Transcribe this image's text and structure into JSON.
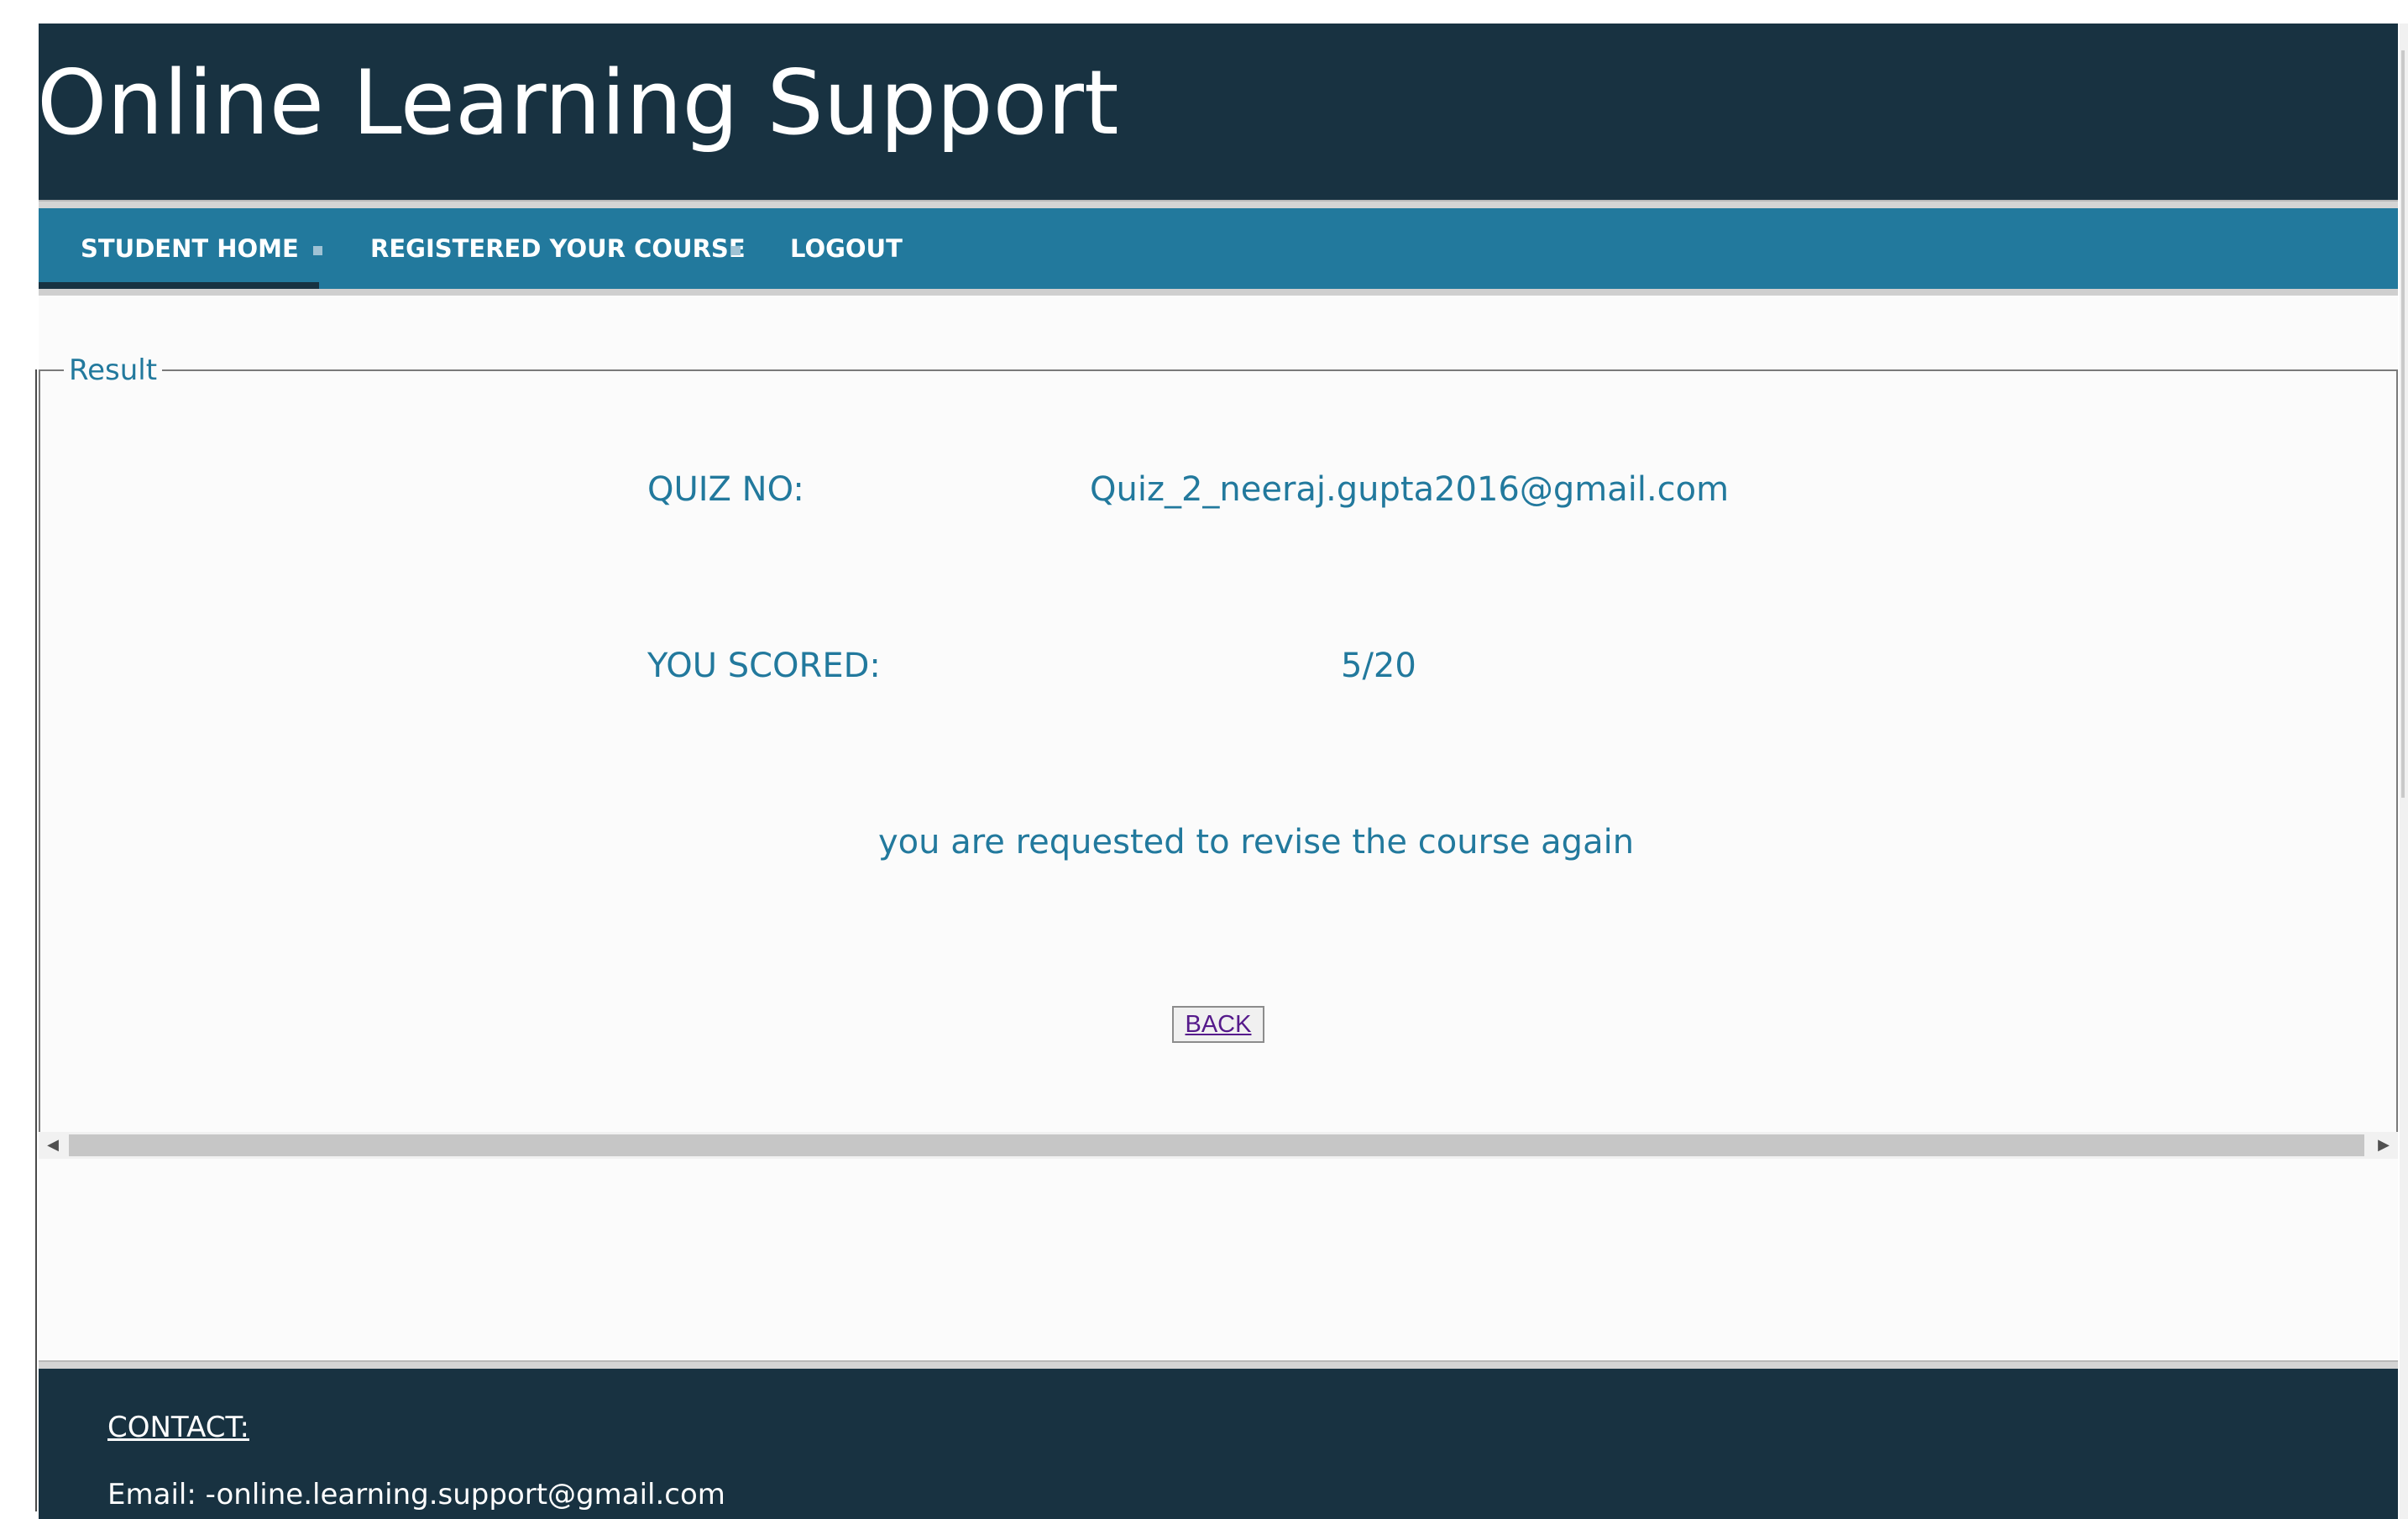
{
  "header": {
    "title": "Online Learning Support"
  },
  "nav": {
    "items": [
      {
        "label": "STUDENT HOME",
        "active": true
      },
      {
        "label": "REGISTERED YOUR COURSE",
        "active": false
      },
      {
        "label": "LOGOUT",
        "active": false
      }
    ]
  },
  "result": {
    "legend": "Result",
    "quiz_label": "QUIZ NO:",
    "quiz_value": "Quiz_2_neeraj.gupta2016@gmail.com",
    "score_label": "YOU SCORED:",
    "score_value": "5/20",
    "message": "you are requested to revise the course again",
    "back_label": "BACK"
  },
  "footer": {
    "contact_heading": "CONTACT:",
    "email_line": "Email: -online.learning.support@gmail.com"
  },
  "icons": {
    "scroll_left": "arrow-left-icon",
    "scroll_right": "arrow-right-icon"
  },
  "colors": {
    "header_bg": "#183241",
    "nav_bg": "#22799d",
    "text_accent": "#22799d",
    "link_visited": "#551a8b"
  }
}
